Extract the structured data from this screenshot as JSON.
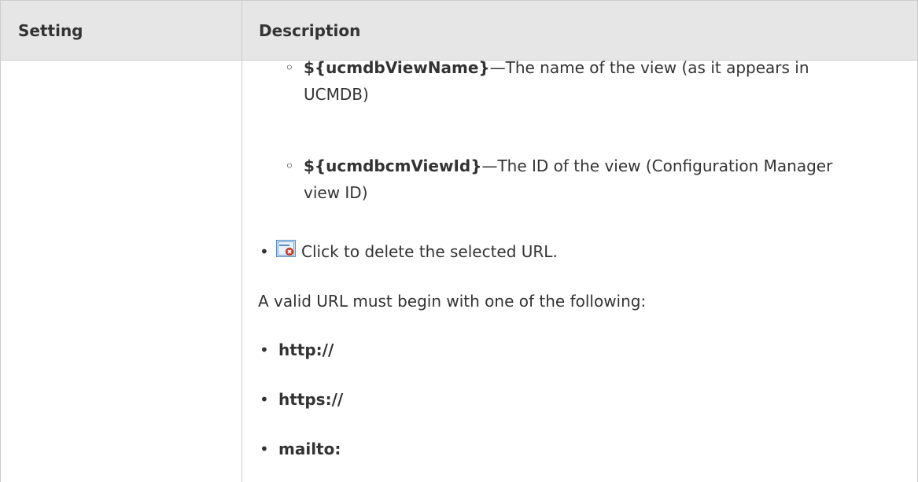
{
  "table": {
    "headers": {
      "setting": "Setting",
      "description": "Description"
    },
    "sub_items": [
      {
        "code": "${ucmdbViewName}",
        "dash": "—",
        "text": "The name of the view (as it appears in",
        "text2": "UCMDB)"
      },
      {
        "code": "${ucmdbcmViewId}",
        "dash": "—",
        "text": "The ID of the view (Configuration Manager",
        "text2": "view ID)"
      }
    ],
    "delete_item": {
      "icon": "delete-url-icon",
      "text": "Click to delete the selected URL."
    },
    "valid_url_intro": "A valid URL must begin with one of the following:",
    "url_prefixes": [
      "http://",
      "https://",
      "mailto:"
    ]
  }
}
